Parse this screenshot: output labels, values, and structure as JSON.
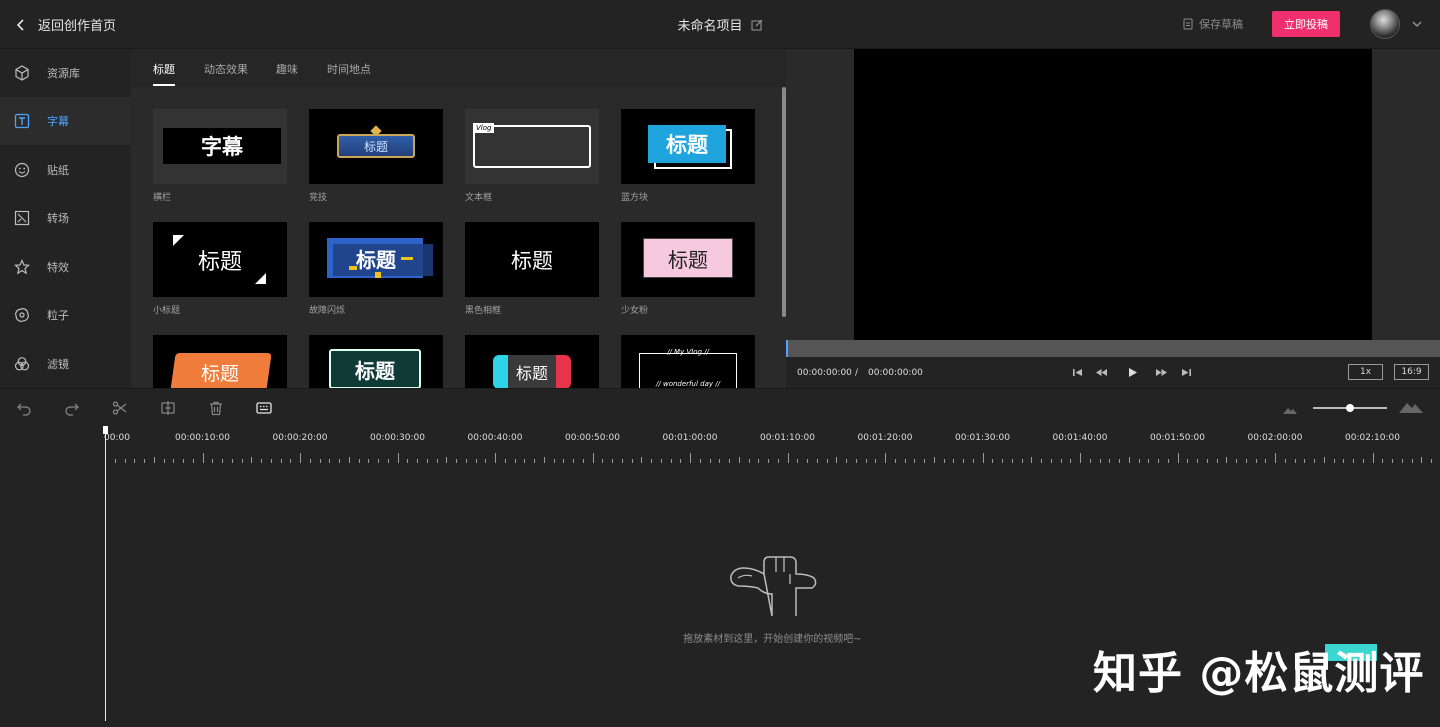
{
  "header": {
    "back_label": "返回创作首页",
    "project_title": "未命名项目",
    "save_draft_label": "保存草稿",
    "publish_label": "立即投稿"
  },
  "sidebar": {
    "items": [
      {
        "label": "资源库",
        "icon": "cube-icon"
      },
      {
        "label": "字幕",
        "icon": "text-icon",
        "active": true
      },
      {
        "label": "贴纸",
        "icon": "sticker-icon"
      },
      {
        "label": "转场",
        "icon": "transition-icon"
      },
      {
        "label": "特效",
        "icon": "star-icon"
      },
      {
        "label": "粒子",
        "icon": "swirl-icon"
      },
      {
        "label": "滤镜",
        "icon": "filter-icon"
      }
    ]
  },
  "panel": {
    "tabs": [
      {
        "label": "标题",
        "active": true
      },
      {
        "label": "动态效果"
      },
      {
        "label": "趣味"
      },
      {
        "label": "时间地点"
      }
    ],
    "tiles": [
      {
        "label": "横栏",
        "text": "字幕"
      },
      {
        "label": "竞技",
        "text": "标题"
      },
      {
        "label": "文本框",
        "text": "Vlog"
      },
      {
        "label": "蓝方块",
        "text": "标题"
      },
      {
        "label": "小标题",
        "text": "标题"
      },
      {
        "label": "故障闪烁",
        "text": "标题"
      },
      {
        "label": "黑色相框",
        "text": "标题"
      },
      {
        "label": "少女粉",
        "text": "标题"
      },
      {
        "label": "",
        "text": "标题"
      },
      {
        "label": "",
        "text": "标题"
      },
      {
        "label": "",
        "text": "标题"
      },
      {
        "label": "",
        "text": "// My Vlog //",
        "text2": "// wonderful day //"
      }
    ]
  },
  "preview": {
    "current_time": "00:00:00:00",
    "separator": "/",
    "total_time": "00:00:00:00",
    "speed_label": "1x",
    "ratio_label": "16:9"
  },
  "timeline": {
    "ruler_labels": [
      "00:00",
      "00:00:10:00",
      "00:00:20:00",
      "00:00:30:00",
      "00:00:40:00",
      "00:00:50:00",
      "00:01:00:00",
      "00:01:10:00",
      "00:01:20:00",
      "00:01:30:00",
      "00:01:40:00",
      "00:01:50:00",
      "00:02:00:00",
      "00:02:10:00"
    ],
    "empty_hint": "拖放素材到这里，开始创建你的视频吧~"
  },
  "watermark": "知乎 @松鼠测评",
  "colors": {
    "accent": "#4fa3ff",
    "publish": "#f0306e",
    "background": "#232323"
  }
}
